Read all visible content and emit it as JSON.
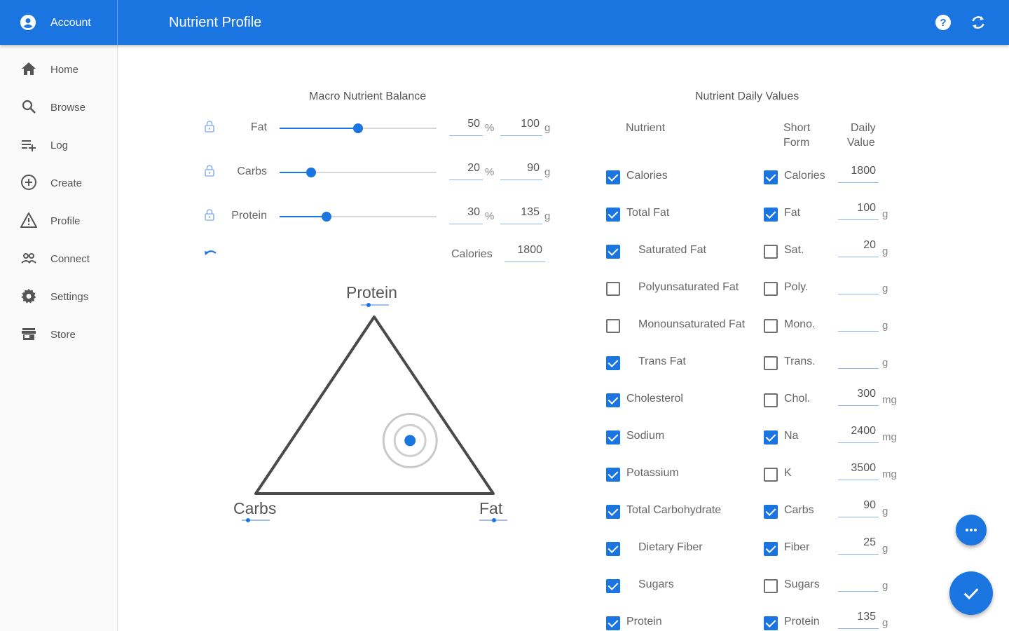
{
  "header": {
    "account_label": "Account",
    "title": "Nutrient Profile",
    "icons": [
      "help-icon",
      "sync-icon"
    ]
  },
  "sidebar": {
    "items": [
      {
        "label": "Home",
        "icon": "home-icon"
      },
      {
        "label": "Browse",
        "icon": "search-icon"
      },
      {
        "label": "Log",
        "icon": "playlist-add-icon"
      },
      {
        "label": "Create",
        "icon": "add-circle-icon"
      },
      {
        "label": "Profile",
        "icon": "warning-triangle-icon"
      },
      {
        "label": "Connect",
        "icon": "people-icon"
      },
      {
        "label": "Settings",
        "icon": "gear-icon"
      },
      {
        "label": "Store",
        "icon": "store-icon"
      }
    ]
  },
  "macro": {
    "title": "Macro Nutrient Balance",
    "rows": [
      {
        "label": "Fat",
        "percent": "50",
        "grams": "100",
        "slider_fraction": 0.5
      },
      {
        "label": "Carbs",
        "percent": "20",
        "grams": "90",
        "slider_fraction": 0.2
      },
      {
        "label": "Protein",
        "percent": "30",
        "grams": "135",
        "slider_fraction": 0.3
      }
    ],
    "percent_unit": "%",
    "gram_unit": "g",
    "calories_label": "Calories",
    "calories_value": "1800",
    "triangle": {
      "top_label": "Protein",
      "left_label": "Carbs",
      "right_label": "Fat",
      "composition": {
        "protein": 0.3,
        "carbs": 0.2,
        "fat": 0.5
      }
    }
  },
  "daily": {
    "title": "Nutrient Daily Values",
    "col_nutrient": "Nutrient",
    "col_short_1": "Short",
    "col_short_2": "Form",
    "col_daily_1": "Daily",
    "col_daily_2": "Value",
    "rows": [
      {
        "name": "Calories",
        "indent": false,
        "checked": true,
        "short": "Calories",
        "short_checked": true,
        "value": "1800",
        "unit": ""
      },
      {
        "name": "Total Fat",
        "indent": false,
        "checked": true,
        "short": "Fat",
        "short_checked": true,
        "value": "100",
        "unit": "g"
      },
      {
        "name": "Saturated Fat",
        "indent": true,
        "checked": true,
        "short": "Sat.",
        "short_checked": false,
        "value": "20",
        "unit": "g"
      },
      {
        "name": "Polyunsaturated Fat",
        "indent": true,
        "checked": false,
        "short": "Poly.",
        "short_checked": false,
        "value": "",
        "unit": "g"
      },
      {
        "name": "Monounsaturated Fat",
        "indent": true,
        "checked": false,
        "short": "Mono.",
        "short_checked": false,
        "value": "",
        "unit": "g"
      },
      {
        "name": "Trans Fat",
        "indent": true,
        "checked": true,
        "short": "Trans.",
        "short_checked": false,
        "value": "",
        "unit": "g"
      },
      {
        "name": "Cholesterol",
        "indent": false,
        "checked": true,
        "short": "Chol.",
        "short_checked": false,
        "value": "300",
        "unit": "mg"
      },
      {
        "name": "Sodium",
        "indent": false,
        "checked": true,
        "short": "Na",
        "short_checked": true,
        "value": "2400",
        "unit": "mg"
      },
      {
        "name": "Potassium",
        "indent": false,
        "checked": true,
        "short": "K",
        "short_checked": false,
        "value": "3500",
        "unit": "mg"
      },
      {
        "name": "Total Carbohydrate",
        "indent": false,
        "checked": true,
        "short": "Carbs",
        "short_checked": true,
        "value": "90",
        "unit": "g"
      },
      {
        "name": "Dietary Fiber",
        "indent": true,
        "checked": true,
        "short": "Fiber",
        "short_checked": true,
        "value": "25",
        "unit": "g"
      },
      {
        "name": "Sugars",
        "indent": true,
        "checked": true,
        "short": "Sugars",
        "short_checked": false,
        "value": "",
        "unit": "g"
      },
      {
        "name": "Protein",
        "indent": false,
        "checked": true,
        "short": "Protein",
        "short_checked": true,
        "value": "135",
        "unit": "g"
      }
    ]
  },
  "colors": {
    "accent": "#1b75e0",
    "triangle": "#4a4a4a"
  },
  "fabs": [
    "more-icon",
    "check-icon"
  ]
}
